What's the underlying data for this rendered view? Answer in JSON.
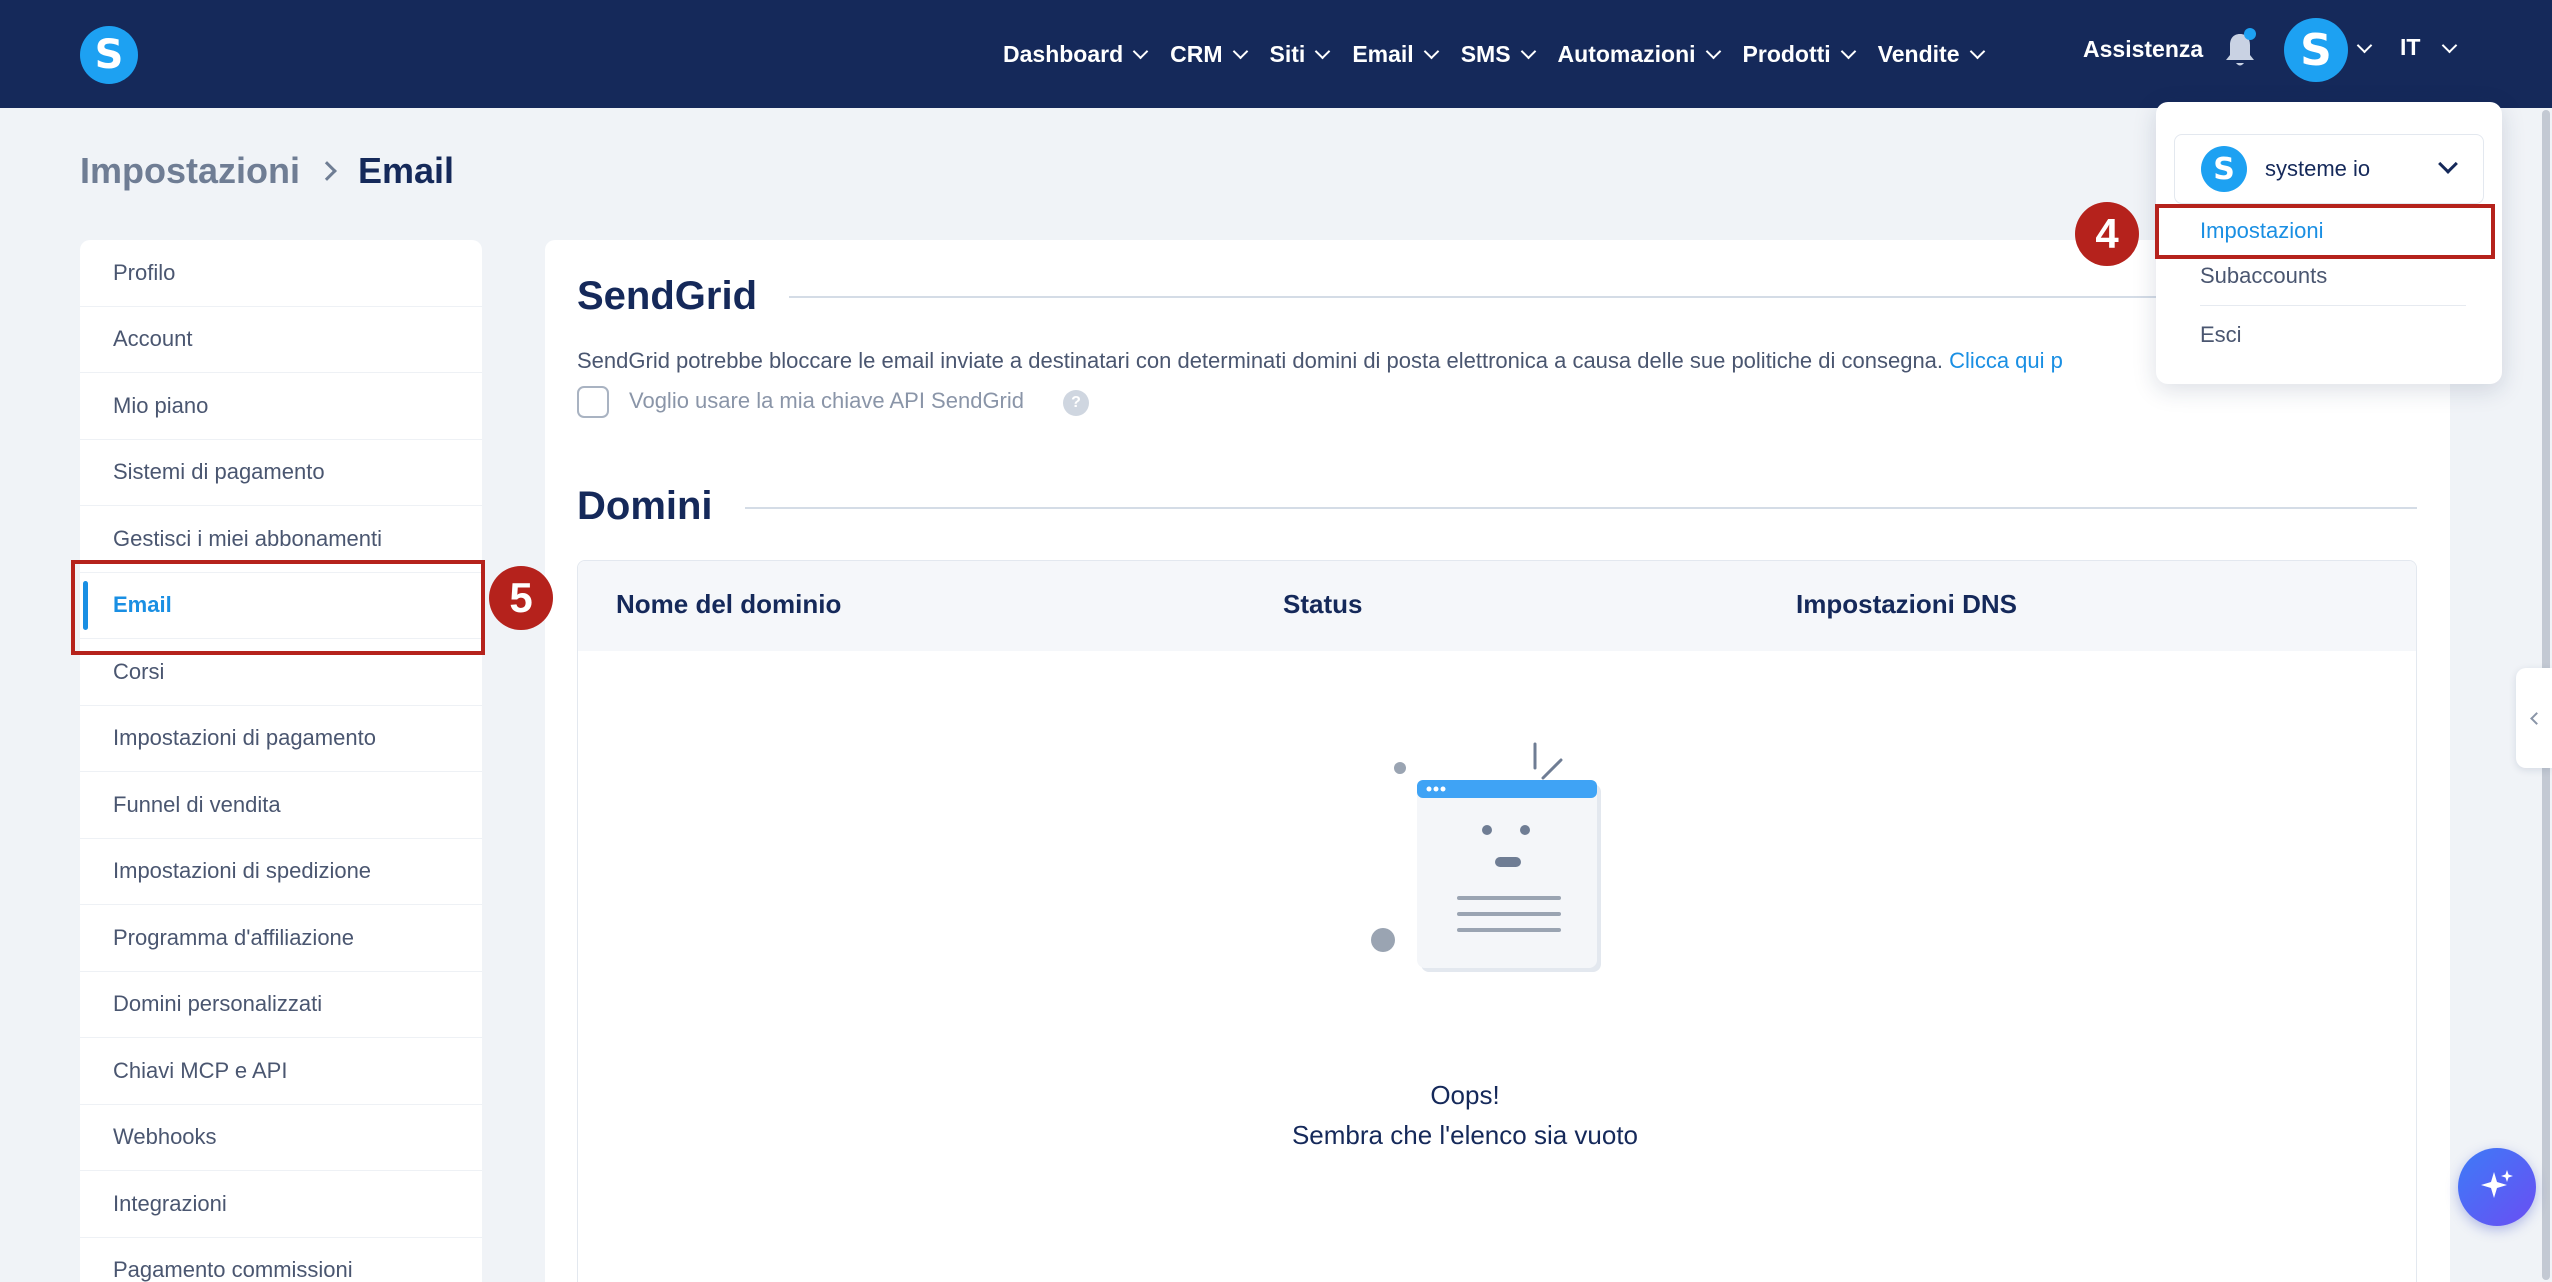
{
  "topbar": {
    "logo_letter": "S",
    "nav": [
      {
        "label": "Dashboard"
      },
      {
        "label": "CRM"
      },
      {
        "label": "Siti"
      },
      {
        "label": "Email"
      },
      {
        "label": "SMS"
      },
      {
        "label": "Automazioni"
      },
      {
        "label": "Prodotti"
      },
      {
        "label": "Vendite"
      }
    ],
    "help_label": "Assistenza",
    "avatar_letter": "S",
    "language": "IT",
    "accent_color": "#1da1f2",
    "bar_color": "#15295a"
  },
  "breadcrumb": {
    "root": "Impostazioni",
    "current": "Email"
  },
  "sidebar": {
    "items": [
      {
        "label": "Profilo"
      },
      {
        "label": "Account"
      },
      {
        "label": "Mio piano"
      },
      {
        "label": "Sistemi di pagamento"
      },
      {
        "label": "Gestisci i miei abbonamenti"
      },
      {
        "label": "Email",
        "active": true
      },
      {
        "label": "Corsi"
      },
      {
        "label": "Impostazioni di pagamento"
      },
      {
        "label": "Funnel di vendita"
      },
      {
        "label": "Impostazioni di spedizione"
      },
      {
        "label": "Programma d'affiliazione"
      },
      {
        "label": "Domini personalizzati"
      },
      {
        "label": "Chiavi MCP e API"
      },
      {
        "label": "Webhooks"
      },
      {
        "label": "Integrazioni"
      },
      {
        "label": "Pagamento commissioni"
      }
    ]
  },
  "sendgrid": {
    "title": "SendGrid",
    "description": "SendGrid potrebbe bloccare le email inviate a destinatari con determinati domini di posta elettronica a causa delle sue politiche di consegna.",
    "link_text": "Clicca qui p",
    "checkbox_label": "Voglio usare la mia chiave API SendGrid",
    "help_glyph": "?"
  },
  "domains": {
    "title": "Domini",
    "columns": [
      "Nome del dominio",
      "Status",
      "Impostazioni DNS"
    ],
    "empty_title": "Oops!",
    "empty_subtitle": "Sembra che l'elenco sia vuoto"
  },
  "account_menu": {
    "account_name": "systeme io",
    "account_logo_letter": "S",
    "items": [
      {
        "label": "Impostazioni",
        "active": true
      },
      {
        "label": "Subaccounts"
      },
      {
        "label": "Esci"
      }
    ]
  },
  "annotations": {
    "step4": "4",
    "step5": "5",
    "color": "#b5221c"
  }
}
